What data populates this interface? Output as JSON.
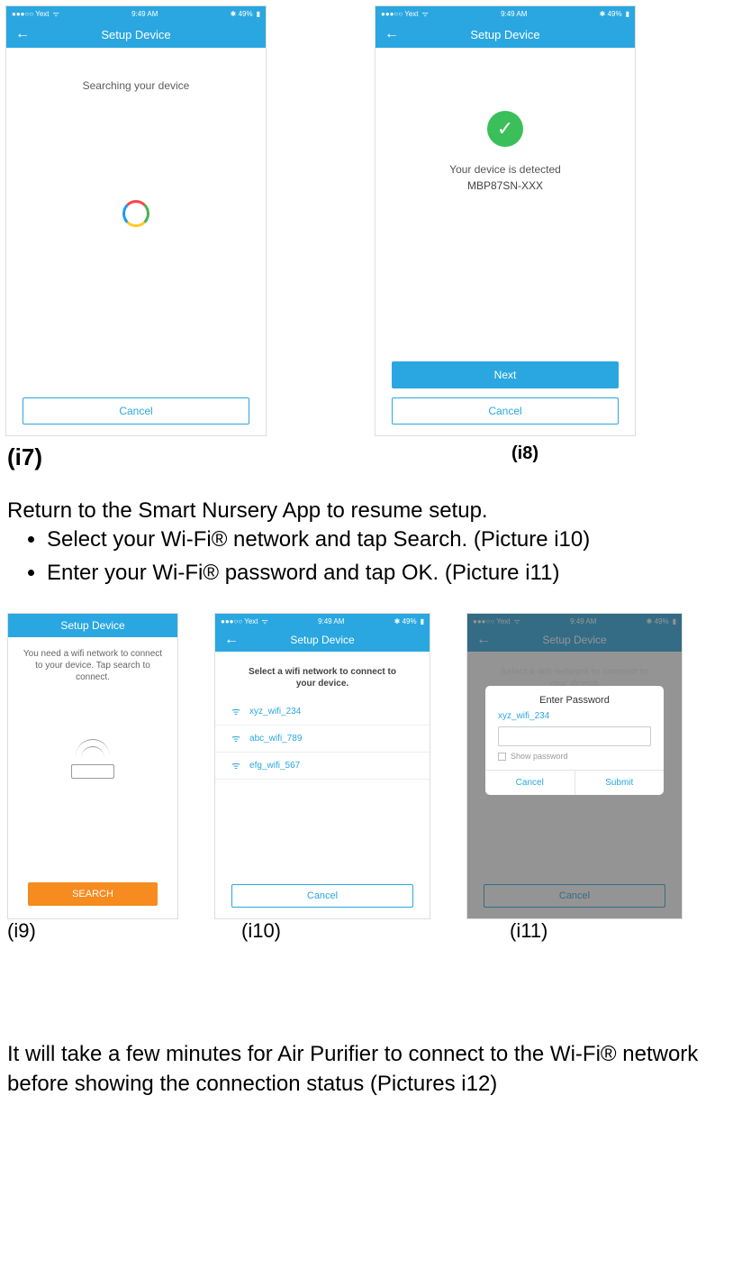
{
  "status": {
    "carrier": "●●●○○ Yext",
    "wifi_glyph": "ᯤ",
    "time": "9:49 AM",
    "bt": "✱ 49%",
    "batt": "▮"
  },
  "nav_title": "Setup Device",
  "i7": {
    "searching": "Searching your device",
    "cancel": "Cancel"
  },
  "i8": {
    "detected": "Your device is detected",
    "device": "MBP87SN-XXX",
    "next": "Next",
    "cancel": "Cancel"
  },
  "labels": {
    "i7": "(i7)",
    "i8": "(i8)",
    "i9": "(i9)",
    "i10": "(i10)",
    "i11": "(i11)"
  },
  "instructions": {
    "intro": "Return to the Smart Nursery App to resume setup.",
    "b1": "Select your Wi-Fi® network and tap Search. (Picture i10)",
    "b2": "Enter your Wi-Fi® password and tap OK. (Picture i11)"
  },
  "i9": {
    "msg": "You need a wifi network to connect to your device. Tap search to connect.",
    "search": "SEARCH"
  },
  "i10": {
    "prompt": "Select a wifi network to connect to your device.",
    "nets": [
      "xyz_wifi_234",
      "abc_wifi_789",
      "efg_wifi_567"
    ],
    "cancel": "Cancel"
  },
  "i11": {
    "prompt": "Select a wifi network to connect to your device.",
    "dlg_title": "Enter Password",
    "selected_net": "xyz_wifi_234",
    "show_pw": "Show password",
    "cancel": "Cancel",
    "submit": "Submit",
    "bottom_cancel": "Cancel"
  },
  "footer": "It will take a few minutes for Air Purifier to connect to the Wi-Fi® network before showing the connection status (Pictures i12)"
}
